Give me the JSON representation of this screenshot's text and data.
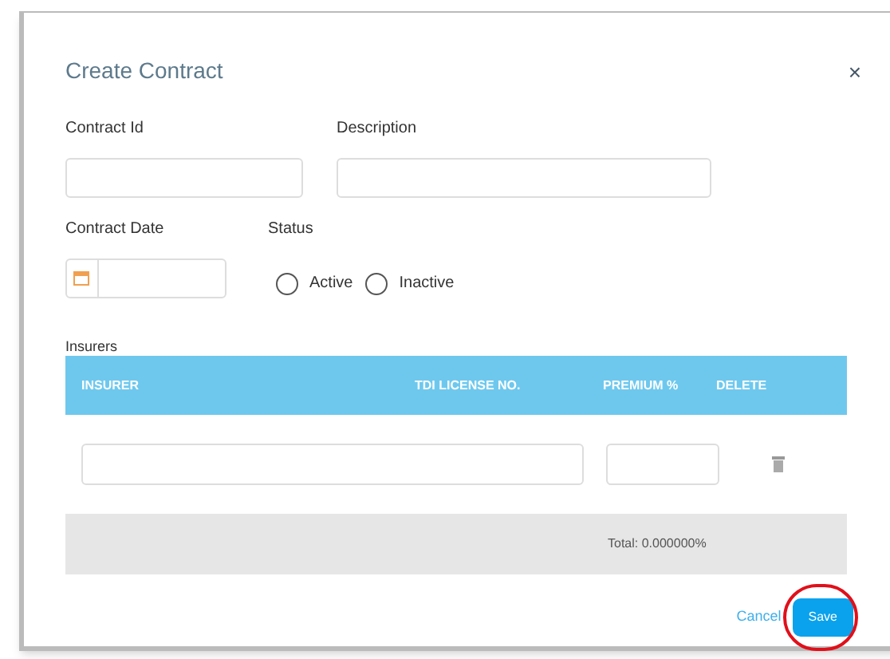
{
  "dialog": {
    "title": "Create Contract",
    "close": "×"
  },
  "fields": [
    {
      "label": "Contract Id"
    },
    {
      "label": "Description"
    }
  ],
  "date_field": {
    "label": "Contract Date"
  },
  "status": {
    "label": "Status",
    "options": [
      {
        "label": "Active",
        "selected": false
      },
      {
        "label": "Inactive",
        "selected": false
      }
    ]
  },
  "insurers": {
    "label": "Insurers",
    "columns": [
      "INSURER",
      "TDI LICENSE NO.",
      "PREMIUM %",
      "DELETE"
    ],
    "total": "Total: 0.000000%"
  },
  "buttons": [
    {
      "label": "Cancel",
      "kind": "link",
      "highlighted": false
    },
    {
      "label": "Save",
      "kind": "primary",
      "highlighted": true
    }
  ]
}
